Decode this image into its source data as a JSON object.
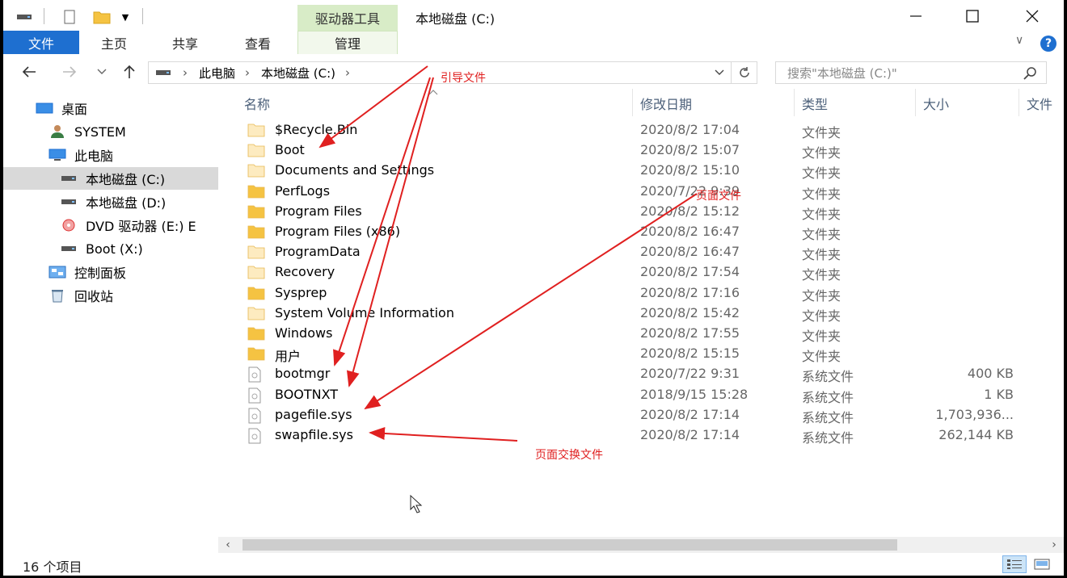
{
  "title_bar": {
    "context_group": "驱动器工具",
    "window_title": "本地磁盘 (C:)",
    "minimize": "—",
    "maximize": "☐",
    "close": "✕"
  },
  "ribbon": {
    "tabs": [
      "文件",
      "主页",
      "共享",
      "查看",
      "管理"
    ],
    "collapse_glyph": "∨",
    "help_glyph": "?"
  },
  "address": {
    "path": [
      "此电脑",
      "本地磁盘 (C:)"
    ],
    "separator": "›",
    "search_placeholder": "搜索\"本地磁盘 (C:)\""
  },
  "nav": {
    "items": [
      {
        "label": "桌面",
        "icon": "desktop-icon"
      },
      {
        "label": "SYSTEM",
        "icon": "user-icon"
      },
      {
        "label": "此电脑",
        "icon": "computer-icon"
      },
      {
        "label": "本地磁盘 (C:)",
        "icon": "drive-icon"
      },
      {
        "label": "本地磁盘 (D:)",
        "icon": "drive-icon"
      },
      {
        "label": "DVD 驱动器 (E:) E",
        "icon": "dvd-icon"
      },
      {
        "label": "Boot (X:)",
        "icon": "drive-icon"
      },
      {
        "label": "控制面板",
        "icon": "control-panel-icon"
      },
      {
        "label": "回收站",
        "icon": "recycle-bin-icon"
      }
    ]
  },
  "columns": {
    "name": "名称",
    "date": "修改日期",
    "type": "类型",
    "size": "大小",
    "extra": "文件"
  },
  "files": [
    {
      "name": "$Recycle.Bin",
      "date": "2020/8/2 17:04",
      "type": "文件夹",
      "size": "",
      "kind": "folder-pale"
    },
    {
      "name": "Boot",
      "date": "2020/8/2 15:07",
      "type": "文件夹",
      "size": "",
      "kind": "folder-pale"
    },
    {
      "name": "Documents and Settings",
      "date": "2020/8/2 15:10",
      "type": "文件夹",
      "size": "",
      "kind": "folder-pale"
    },
    {
      "name": "PerfLogs",
      "date": "2020/7/22 9:39",
      "type": "文件夹",
      "size": "",
      "kind": "folder"
    },
    {
      "name": "Program Files",
      "date": "2020/8/2 15:12",
      "type": "文件夹",
      "size": "",
      "kind": "folder"
    },
    {
      "name": "Program Files (x86)",
      "date": "2020/8/2 16:47",
      "type": "文件夹",
      "size": "",
      "kind": "folder"
    },
    {
      "name": "ProgramData",
      "date": "2020/8/2 16:47",
      "type": "文件夹",
      "size": "",
      "kind": "folder-pale"
    },
    {
      "name": "Recovery",
      "date": "2020/8/2 17:54",
      "type": "文件夹",
      "size": "",
      "kind": "folder-pale"
    },
    {
      "name": "Sysprep",
      "date": "2020/8/2 17:16",
      "type": "文件夹",
      "size": "",
      "kind": "folder"
    },
    {
      "name": "System Volume Information",
      "date": "2020/8/2 15:42",
      "type": "文件夹",
      "size": "",
      "kind": "folder-pale"
    },
    {
      "name": "Windows",
      "date": "2020/8/2 17:55",
      "type": "文件夹",
      "size": "",
      "kind": "folder"
    },
    {
      "name": "用户",
      "date": "2020/8/2 15:15",
      "type": "文件夹",
      "size": "",
      "kind": "folder"
    },
    {
      "name": "bootmgr",
      "date": "2020/7/22 9:31",
      "type": "系统文件",
      "size": "400 KB",
      "kind": "sysfile"
    },
    {
      "name": "BOOTNXT",
      "date": "2018/9/15 15:28",
      "type": "系统文件",
      "size": "1 KB",
      "kind": "sysfile"
    },
    {
      "name": "pagefile.sys",
      "date": "2020/8/2 17:14",
      "type": "系统文件",
      "size": "1,703,936...",
      "kind": "sysfile"
    },
    {
      "name": "swapfile.sys",
      "date": "2020/8/2 17:14",
      "type": "系统文件",
      "size": "262,144 KB",
      "kind": "sysfile"
    }
  ],
  "status": {
    "count": "16 个项目"
  },
  "annotations": {
    "boot_files": "引导文件",
    "page_file": "页面文件",
    "swap_file": "页面交换文件"
  },
  "colors": {
    "accent": "#1e6fd0",
    "context_tab": "#d8ecc7",
    "selection": "#d9d9d9",
    "folder": "#f5c342",
    "folder_pale": "#fdebc0",
    "annotation": "#e02020"
  }
}
